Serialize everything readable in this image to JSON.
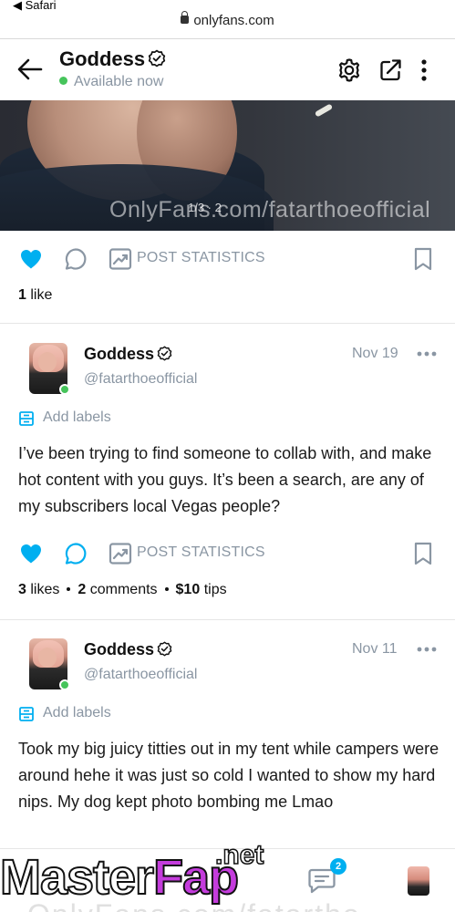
{
  "browser": {
    "back_app": "◀ Safari",
    "url": "onlyfans.com"
  },
  "header": {
    "title": "Goddess",
    "status": "Available now"
  },
  "media": {
    "watermark": "OnlyFans.com/fatarthoeofficial",
    "counter": "1/3 · 2"
  },
  "first_post": {
    "post_statistics_label": "POST STATISTICS",
    "likes_number": "1",
    "likes_word": "like"
  },
  "posts": [
    {
      "author": "Goddess",
      "handle": "@fatarthoeofficial",
      "date": "Nov 19",
      "labels_action": "Add labels",
      "text": "I’ve been trying to find someone to collab with, and make hot content with you guys. It’s been a search, are any of my subscribers local Vegas people?",
      "post_statistics_label": "POST STATISTICS",
      "likes_number": "3",
      "likes_word": "likes",
      "comments_number": "2",
      "comments_word": "comments",
      "tips_amount": "$10",
      "tips_word": "tips"
    },
    {
      "author": "Goddess",
      "handle": "@fatarthoeofficial",
      "date": "Nov 11",
      "labels_action": "Add labels",
      "text": "Took my big juicy titties out in my tent while campers were around hehe it was just so cold I wanted to show my hard nips. My dog kept photo bombing me Lmao"
    }
  ],
  "bottom_nav": {
    "messages_badge": "2"
  },
  "overlay": {
    "logo_master": "Master",
    "logo_fap": "Fap",
    "logo_net": ".net",
    "faded_text": "OnlyFans.com/fatartho"
  },
  "colors": {
    "accent": "#00aff0",
    "muted": "#8a96a3",
    "online": "#46c45b"
  }
}
